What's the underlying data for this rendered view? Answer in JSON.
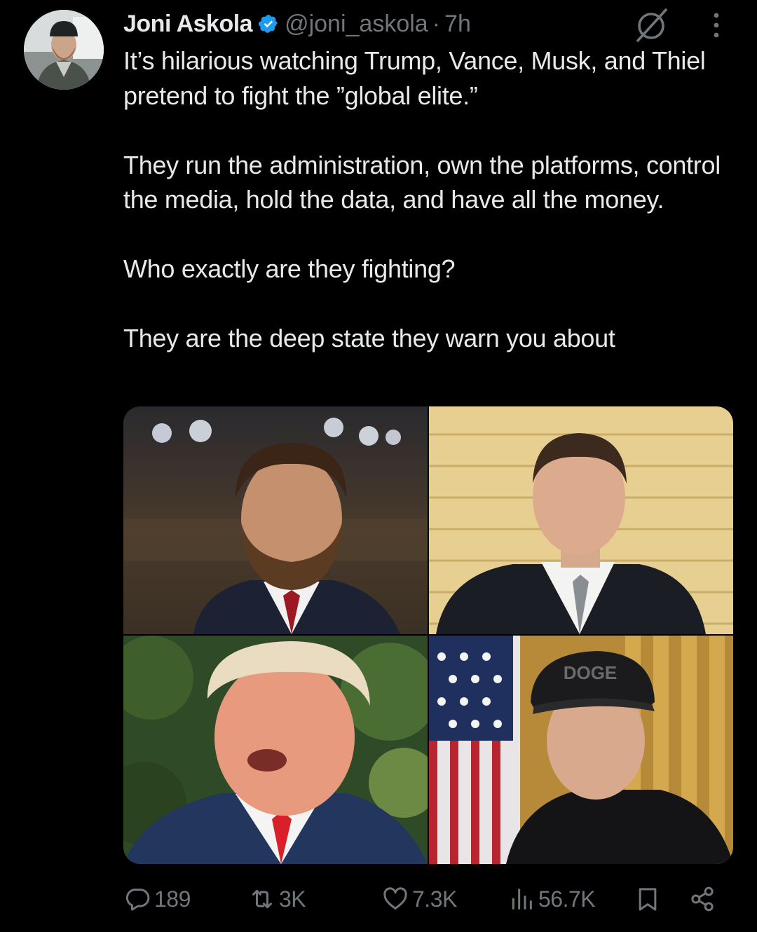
{
  "author": {
    "name": "Joni Askola",
    "handle": "@joni_askola",
    "separator": "·",
    "time": "7h",
    "verified": true
  },
  "tweet": {
    "paragraphs": [
      "It’s hilarious watching Trump, Vance, Musk, and Thiel pretend to fight the ”global elite.”",
      "They run the administration, own the platforms, control the media, hold the data, and have all the money.",
      "Who exactly are they fighting?",
      "They are the deep state they warn you about"
    ]
  },
  "media": {
    "images": [
      {
        "icon": "vance-photo"
      },
      {
        "icon": "thiel-photo"
      },
      {
        "icon": "trump-photo"
      },
      {
        "icon": "musk-photo",
        "cap_text": "DOGE"
      }
    ]
  },
  "actions": {
    "replies": "189",
    "reposts": "3K",
    "likes": "7.3K",
    "views": "56.7K"
  },
  "colors": {
    "background": "#000000",
    "text": "#e7e9ea",
    "secondary": "#71767b",
    "verified": "#1d9bf0"
  }
}
